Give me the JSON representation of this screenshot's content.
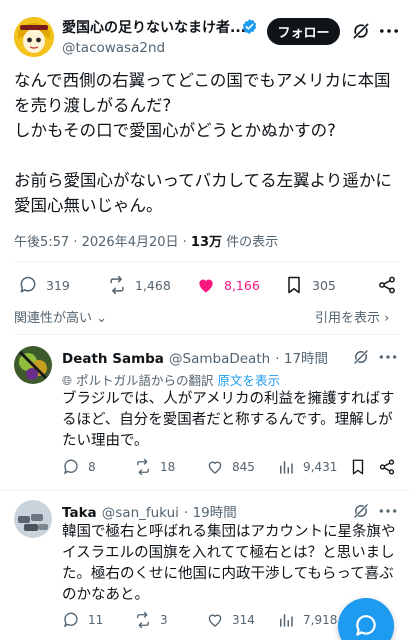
{
  "colors": {
    "accent": "#1d9bf0",
    "like": "#f91880",
    "text": "#0f1419",
    "muted": "#536471"
  },
  "post": {
    "display_name": "愛国心の足りないなまけ者...",
    "handle": "@tacowasa2nd",
    "follow_label": "フォロー",
    "body": "なんで西側の右翼ってどこの国でもアメリカに本国\nを売り渡しがるんだ?\nしかもその口で愛国心がどうとかぬかすの?\n\nお前ら愛国心がないってバカしてる左翼より遥かに\n愛国心無いじゃん。",
    "time": "午後5:57",
    "date": "2026年4月20日",
    "views_count": "13万",
    "views_suffix": "件の表示",
    "stats": {
      "replies": "319",
      "reposts": "1,468",
      "likes": "8,166",
      "bookmarks": "305"
    }
  },
  "sort": {
    "left_label": "関連性が高い",
    "right_label": "引用を表示"
  },
  "replies": [
    {
      "name": "Death Samba",
      "handle": "@SambaDeath",
      "time": "· 17時間",
      "translated_from": "ポルトガル語からの翻訳",
      "show_original": "原文を表示",
      "text": "ブラジルでは、人がアメリカの利益を擁護すればす\nるほど、自分を愛国者だと称するんです。理解しが\nたい理由で。",
      "replies": "8",
      "reposts": "18",
      "likes": "845",
      "views": "9,431"
    },
    {
      "name": "Taka",
      "handle": "@san_fukui",
      "time": "· 19時間",
      "text": "韓国で極右と呼ばれる集団はアカウントに星条旗や\nイスラエルの国旗を入れてて極右とは？と思いまし\nた。極右のくせに他国に内政干渉してもらって喜ぶ\nのかなあと。",
      "replies": "11",
      "reposts": "3",
      "likes": "314",
      "views": "7,918"
    }
  ]
}
